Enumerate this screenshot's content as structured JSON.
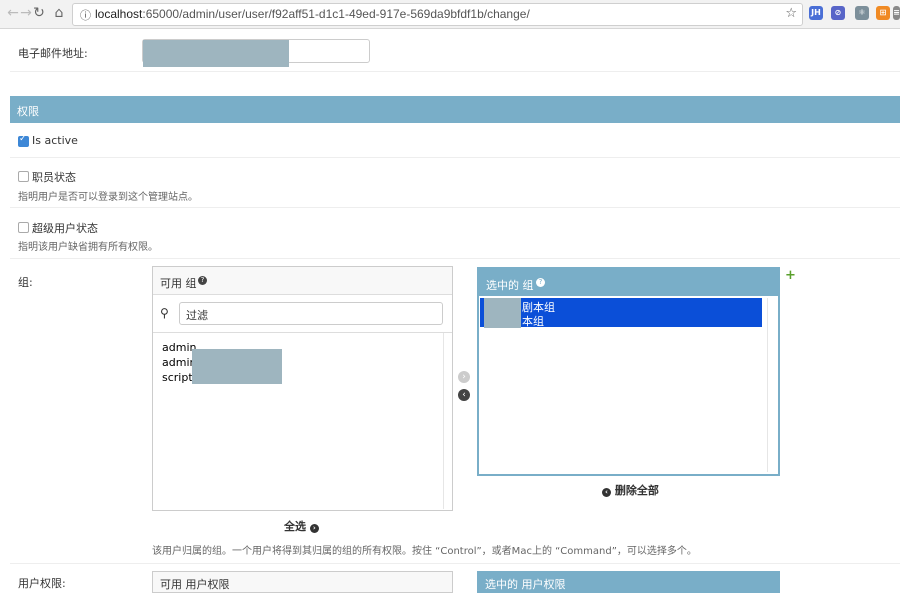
{
  "browser": {
    "back_icon": "←",
    "forward_icon": "→",
    "reload_icon": "↻",
    "home_icon": "⌂",
    "url_host": "localhost",
    "url_path": ":65000/admin/user/user/f92aff51-d1c1-49ed-917e-569da9bfdf1b/change/",
    "extensions": [
      "JH",
      "⊘",
      "⚛",
      "⊞",
      "≡"
    ]
  },
  "form": {
    "email_label": "电子邮件地址:",
    "permissions_section": "权限",
    "is_active_label": "Is active",
    "is_active_checked": true,
    "staff_label": "职员状态",
    "staff_checked": false,
    "staff_help": "指明用户是否可以登录到这个管理站点。",
    "superuser_label": "超级用户状态",
    "superuser_checked": false,
    "superuser_help": "指明该用户缺省拥有所有权限。",
    "groups_label": "组:",
    "groups_help": "该用户归属的组。一个用户将得到其归属的组的所有权限。按住 “Control”，或者Mac上的 “Command”，可以选择多个。",
    "user_perms_label": "用户权限:"
  },
  "available_groups": {
    "title": "可用 组",
    "filter_placeholder": "过滤",
    "options": [
      "admin",
      "admin",
      "script_"
    ],
    "choose_all": "全选"
  },
  "chosen_groups": {
    "title": "选中的 组",
    "options": [
      "剧本组",
      "本组"
    ],
    "remove_all": "删除全部"
  },
  "perms_boxes": {
    "available_title": "可用 用户权限",
    "chosen_title": "选中的 用户权限"
  },
  "colors": {
    "header_blue": "#79aec8",
    "selected_blue": "#0b4fd8",
    "add_green": "#5aa02c"
  }
}
